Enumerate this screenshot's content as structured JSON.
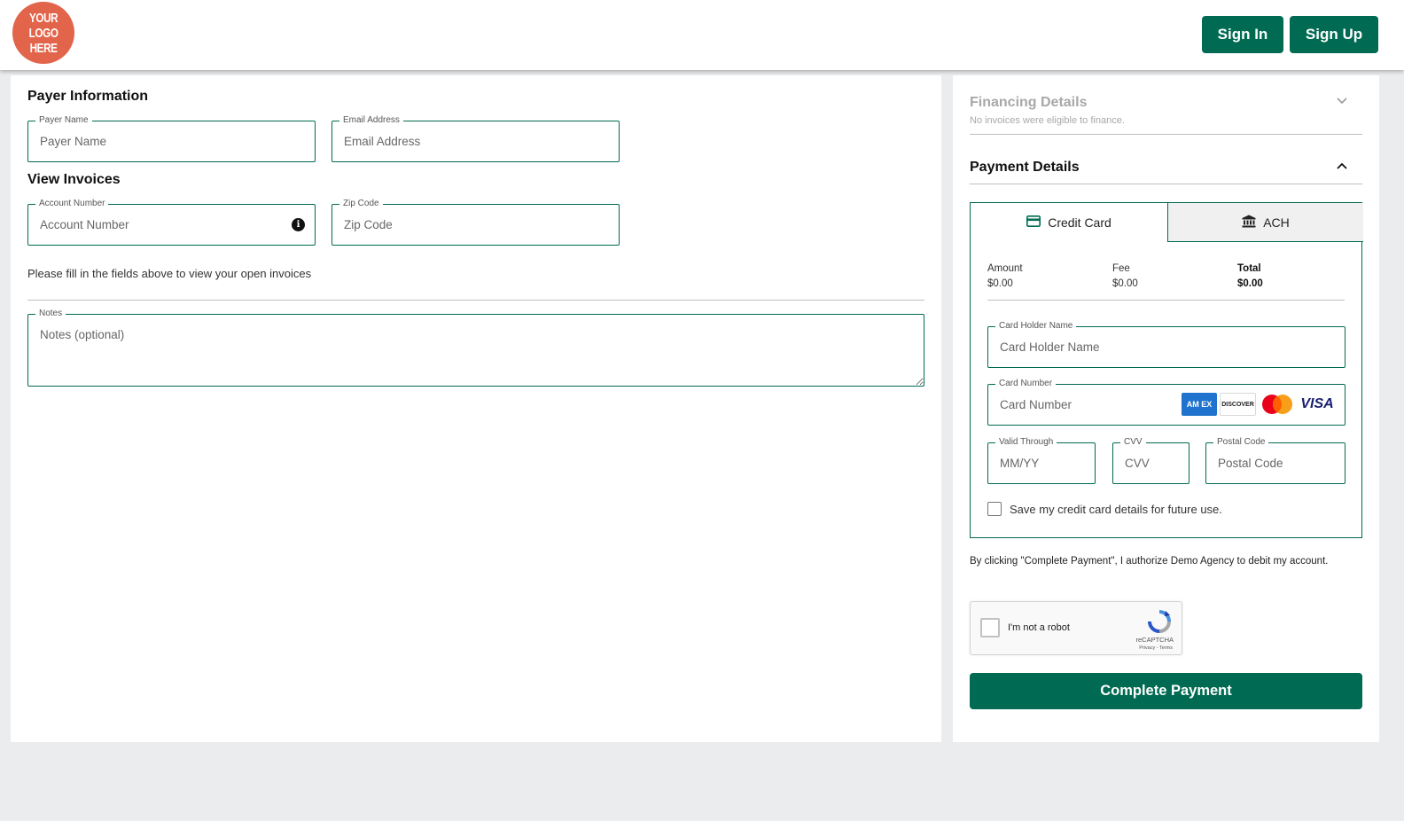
{
  "header": {
    "logo_text": "YOUR\nLOGO\nHERE",
    "sign_in_label": "Sign In",
    "sign_up_label": "Sign Up"
  },
  "payer_information": {
    "title": "Payer Information",
    "payer_name": {
      "label": "Payer Name",
      "placeholder": "Payer Name",
      "value": ""
    },
    "email_address": {
      "label": "Email Address",
      "placeholder": "Email Address",
      "value": ""
    }
  },
  "view_invoices": {
    "title": "View Invoices",
    "account_number": {
      "label": "Account Number",
      "placeholder": "Account Number",
      "value": ""
    },
    "zip_code": {
      "label": "Zip Code",
      "placeholder": "Zip Code",
      "value": ""
    },
    "helper_text": "Please fill in the fields above to view your open invoices"
  },
  "notes": {
    "label": "Notes",
    "placeholder": "Notes (optional)",
    "value": ""
  },
  "financing": {
    "title": "Financing Details",
    "subtitle": "No invoices were eligible to finance.",
    "expanded": false
  },
  "payment": {
    "title": "Payment Details",
    "expanded": true,
    "tabs": [
      {
        "label": "Credit Card",
        "icon": "credit-card-icon",
        "active": true
      },
      {
        "label": "ACH",
        "icon": "bank-icon",
        "active": false
      }
    ],
    "summary": {
      "amount_label": "Amount",
      "amount_value": "$0.00",
      "fee_label": "Fee",
      "fee_value": "$0.00",
      "total_label": "Total",
      "total_value": "$0.00"
    },
    "card_holder": {
      "label": "Card Holder Name",
      "placeholder": "Card Holder Name",
      "value": ""
    },
    "card_number": {
      "label": "Card Number",
      "placeholder": "Card Number",
      "value": ""
    },
    "card_brands": [
      "amex-logo",
      "discover-logo",
      "mastercard-logo",
      "visa-logo"
    ],
    "brand_text": {
      "amex": "AM EX",
      "discover": "DISCOVER",
      "visa": "VISA"
    },
    "valid_through": {
      "label": "Valid Through",
      "placeholder": "MM/YY",
      "value": ""
    },
    "cvv": {
      "label": "CVV",
      "placeholder": "CVV",
      "value": ""
    },
    "postal_code": {
      "label": "Postal Code",
      "placeholder": "Postal Code",
      "value": ""
    },
    "save_card_label": "Save my credit card details for future use.",
    "save_card_checked": false,
    "authorization_text": "By clicking \"Complete Payment\", I authorize Demo Agency to debit my account.",
    "recaptcha": {
      "label": "I'm not a robot",
      "brand": "reCAPTCHA",
      "links": "Privacy - Terms"
    },
    "complete_label": "Complete Payment"
  },
  "colors": {
    "primary": "#006b52",
    "logo": "#e2644a",
    "background": "#ebecee",
    "muted_text": "#a8a8a8"
  }
}
